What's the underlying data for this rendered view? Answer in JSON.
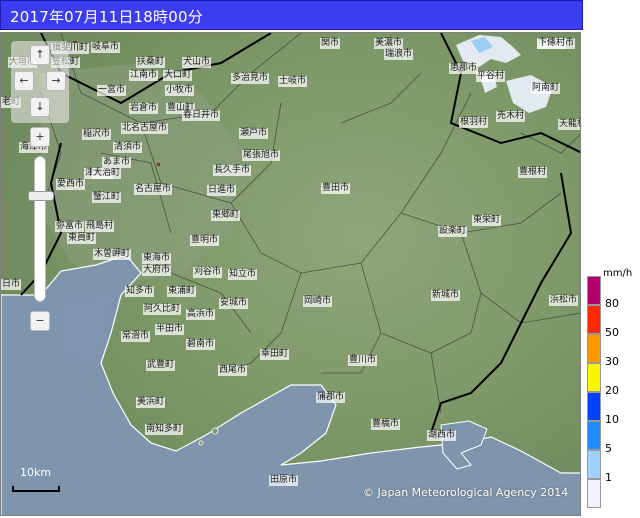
{
  "header": {
    "title": "2017年07月11日18時00分"
  },
  "map": {
    "colors": {
      "land": "#7f9a6a",
      "sea": "#7f95ad",
      "boundary": "#3a3a3a",
      "prefecture_line": "#000000",
      "coast": "#ffffff"
    },
    "places": [
      {
        "name": "揖斐川町"
      },
      {
        "name": "大垣市"
      },
      {
        "name": "岐阜市"
      },
      {
        "name": "関市"
      },
      {
        "name": "美濃市"
      },
      {
        "name": "瑞浪市"
      },
      {
        "name": "恵那市"
      },
      {
        "name": "中津川市"
      },
      {
        "name": "下條村"
      },
      {
        "name": "笠松町"
      },
      {
        "name": "扶桑町"
      },
      {
        "name": "犬山市"
      },
      {
        "name": "江南市"
      },
      {
        "name": "大口町"
      },
      {
        "name": "多治見市"
      },
      {
        "name": "土岐市"
      },
      {
        "name": "平谷村"
      },
      {
        "name": "阿南町"
      },
      {
        "name": "一宮市"
      },
      {
        "name": "小牧市"
      },
      {
        "name": "岩倉市"
      },
      {
        "name": "豊山町"
      },
      {
        "name": "春日井市"
      },
      {
        "name": "老町"
      },
      {
        "name": "北名古屋市"
      },
      {
        "name": "稲沢市"
      },
      {
        "name": "瀬戸市"
      },
      {
        "name": "根羽村"
      },
      {
        "name": "売木村"
      },
      {
        "name": "天龍村"
      },
      {
        "name": "海津市"
      },
      {
        "name": "清須市"
      },
      {
        "name": "津島市"
      },
      {
        "name": "大治町"
      },
      {
        "name": "尾張旭市"
      },
      {
        "name": "あま市"
      },
      {
        "name": "長久手市"
      },
      {
        "name": "愛西市"
      },
      {
        "name": "名古屋市"
      },
      {
        "name": "豊田市"
      },
      {
        "name": "豊根村"
      },
      {
        "name": "蟹江町"
      },
      {
        "name": "日進市"
      },
      {
        "name": "設楽町"
      },
      {
        "name": "東栄町"
      },
      {
        "name": "東郷町"
      },
      {
        "name": "弥富市"
      },
      {
        "name": "飛島村"
      },
      {
        "name": "東員町"
      },
      {
        "name": "木曽岬町"
      },
      {
        "name": "豊明市"
      },
      {
        "name": "東海市"
      },
      {
        "name": "刈谷市"
      },
      {
        "name": "日市"
      },
      {
        "name": "大府市"
      },
      {
        "name": "知立市"
      },
      {
        "name": "知多市"
      },
      {
        "name": "東浦町"
      },
      {
        "name": "浜松市"
      },
      {
        "name": "阿久比町"
      },
      {
        "name": "高浜市"
      },
      {
        "name": "安城市"
      },
      {
        "name": "岡崎市"
      },
      {
        "name": "新城市"
      },
      {
        "name": "半田市"
      },
      {
        "name": "常滑市"
      },
      {
        "name": "碧南市"
      },
      {
        "name": "武豊町"
      },
      {
        "name": "西尾市"
      },
      {
        "name": "幸田町"
      },
      {
        "name": "豊川市"
      },
      {
        "name": "蒲郡市"
      },
      {
        "name": "美浜町"
      },
      {
        "name": "南知多町"
      },
      {
        "name": "豊橋市"
      },
      {
        "name": "湖西市"
      },
      {
        "name": "田原市"
      }
    ]
  },
  "controls": {
    "pan_up": "↑",
    "pan_left": "←",
    "pan_right": "→",
    "pan_down": "↓",
    "zoom_in": "+",
    "zoom_out": "−"
  },
  "scale_bar": {
    "label": "10km"
  },
  "copyright": "© Japan Meteorological Agency 2014",
  "legend": {
    "unit": "mm/h",
    "items": [
      {
        "label": "80",
        "color": "#b4006e"
      },
      {
        "label": "50",
        "color": "#ff2800"
      },
      {
        "label": "30",
        "color": "#ff9900"
      },
      {
        "label": "20",
        "color": "#faf500"
      },
      {
        "label": "10",
        "color": "#0041ff"
      },
      {
        "label": "5",
        "color": "#218cff"
      },
      {
        "label": "1",
        "color": "#a0d2ff"
      },
      {
        "label": "",
        "color": "#f2f2ff"
      }
    ]
  }
}
